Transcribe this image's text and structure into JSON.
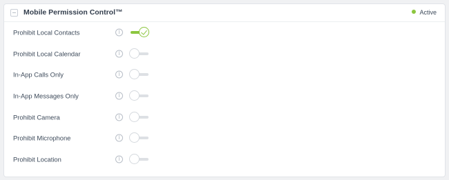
{
  "panel": {
    "title": "Mobile Permission Control™",
    "status": {
      "label": "Active",
      "color": "#8cc63f"
    }
  },
  "settings": [
    {
      "label": "Prohibit Local Contacts",
      "enabled": true
    },
    {
      "label": "Prohibit Local Calendar",
      "enabled": false
    },
    {
      "label": "In-App Calls Only",
      "enabled": false
    },
    {
      "label": "In-App Messages Only",
      "enabled": false
    },
    {
      "label": "Prohibit Camera",
      "enabled": false
    },
    {
      "label": "Prohibit Microphone",
      "enabled": false
    },
    {
      "label": "Prohibit Location",
      "enabled": false
    }
  ],
  "icons": {
    "info": "info-icon",
    "collapse": "collapse-icon"
  },
  "colors": {
    "accent": "#8cc63f",
    "toggle_off_track": "#dde0e4"
  }
}
